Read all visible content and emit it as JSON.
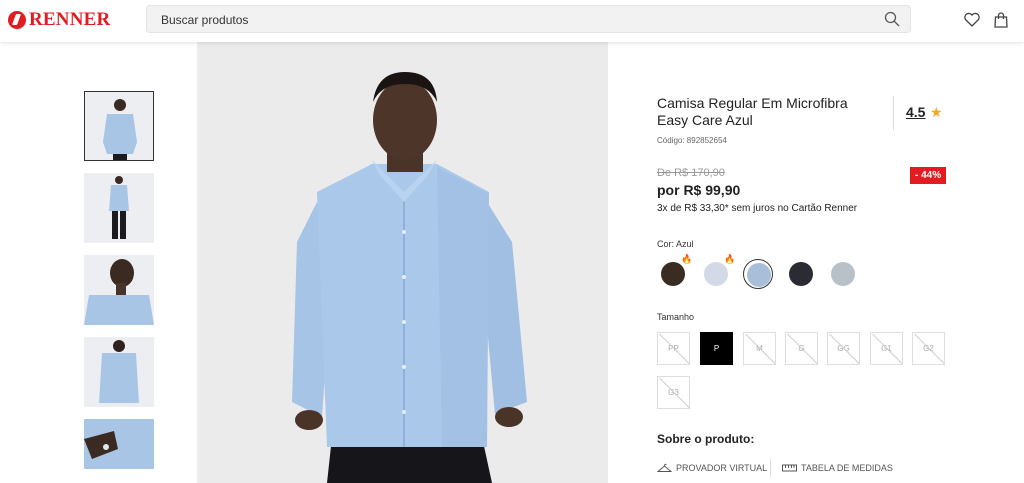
{
  "header": {
    "brand": "RENNER",
    "search_placeholder": "Buscar produtos",
    "icons": [
      "search-icon",
      "heart-icon",
      "shopping-bag-icon"
    ]
  },
  "product": {
    "title": "Camisa Regular Em Microfibra Easy Care Azul",
    "rating": "4.5",
    "code": "Código: 892852654",
    "old_price": "De R$ 170,90",
    "price": "por R$ 99,90",
    "installments": "3x de R$ 33,30* sem juros no Cartão Renner",
    "discount": "- 44%"
  },
  "colors": {
    "label": "Cor:",
    "selected": "Azul",
    "swatches": [
      {
        "hex": "#3b2c22",
        "hot": true
      },
      {
        "hex": "#d3d9e6",
        "hot": true
      },
      {
        "hex": "#a9bed8",
        "selected": true
      },
      {
        "hex": "#2a2b33"
      },
      {
        "hex": "#b8c0c8"
      }
    ]
  },
  "sizes": {
    "label": "Tamanho",
    "options": [
      "PP",
      "P",
      "M",
      "G",
      "GG",
      "G1",
      "G2",
      "G3"
    ],
    "selected": "P"
  },
  "about": {
    "heading": "Sobre o produto:",
    "fitting_room": "PROVADOR VIRTUAL",
    "size_chart": "TABELA DE MEDIDAS"
  }
}
